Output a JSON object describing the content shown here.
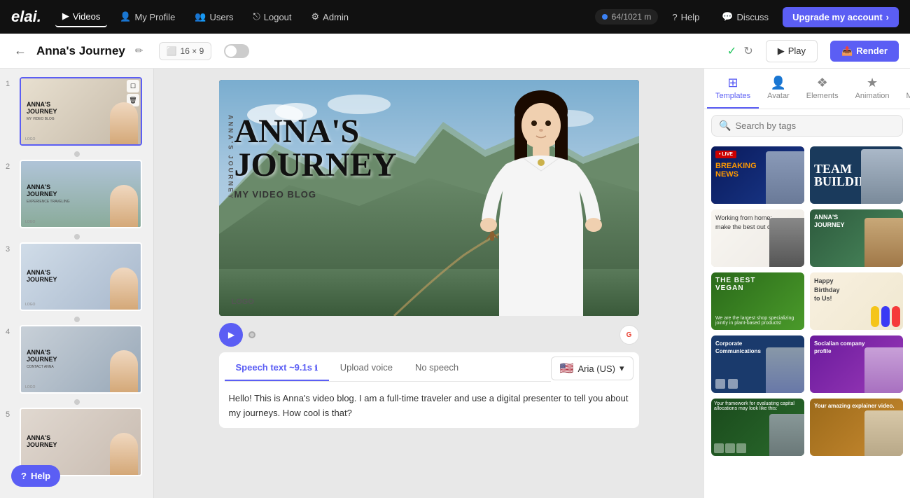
{
  "brand": {
    "logo": "elai."
  },
  "nav": {
    "items": [
      {
        "id": "videos",
        "label": "Videos",
        "icon": "▶",
        "active": true
      },
      {
        "id": "my-profile",
        "label": "My Profile",
        "icon": "👤",
        "active": false
      },
      {
        "id": "users",
        "label": "Users",
        "icon": "👥",
        "active": false
      },
      {
        "id": "logout",
        "label": "Logout",
        "icon": "⎋",
        "active": false
      },
      {
        "id": "admin",
        "label": "Admin",
        "icon": "⚙",
        "active": false
      }
    ],
    "usage": "64/1021 m",
    "help_label": "Help",
    "discuss_label": "Discuss",
    "upgrade_label": "Upgrade my account"
  },
  "secondary_bar": {
    "project_title": "Anna's Journey",
    "aspect_ratio": "16 × 9",
    "play_label": "Play",
    "render_label": "Render"
  },
  "slides": [
    {
      "num": "1",
      "title": "ANNA'S\nJOURNEY",
      "sub": "MY VIDEO BLOG",
      "logo": "LOGO"
    },
    {
      "num": "2",
      "title": "ANNA'S\nJOURNEY",
      "sub": "EXPERIENCE TRAVELING",
      "logo": "LOGO"
    },
    {
      "num": "3",
      "title": "ANNA'S\nJOURNEY",
      "sub": "",
      "logo": "LOGO"
    },
    {
      "num": "4",
      "title": "ANNA'S\nJOURNEY",
      "sub": "CONTACT ANNA",
      "logo": "LOGO"
    },
    {
      "num": "5",
      "title": "ANNA'S\nJOURNEY",
      "sub": "",
      "logo": "LOGO"
    }
  ],
  "canvas": {
    "title_line1": "ANNA'S",
    "title_line2": "JOURNEY",
    "subtitle": "MY VIDEO BLOG",
    "logo": "LOGO",
    "side_text": "ANNA'S JOURNEY"
  },
  "speech": {
    "tab_speech": "Speech text ~9.1s",
    "tab_upload": "Upload voice",
    "tab_none": "No speech",
    "voice_label": "Aria (US)",
    "content": "Hello! This is Anna's video blog. I am a full-time traveler and use a digital presenter to tell you about my journeys. How cool is that?"
  },
  "right_panel": {
    "tabs": [
      {
        "id": "templates",
        "label": "Templates",
        "icon": "⊞",
        "active": true
      },
      {
        "id": "avatar",
        "label": "Avatar",
        "icon": "👤",
        "active": false
      },
      {
        "id": "elements",
        "label": "Elements",
        "icon": "❖",
        "active": false
      },
      {
        "id": "animation",
        "label": "Animation",
        "icon": "★",
        "active": false
      },
      {
        "id": "music",
        "label": "Music",
        "icon": "♪",
        "active": false
      }
    ],
    "search_placeholder": "Search by tags",
    "templates": [
      {
        "id": 1,
        "label": "LIVE BREAKING NEWS",
        "style": "tc-1"
      },
      {
        "id": 2,
        "label": "TEAM BUILDING",
        "style": "tc-2"
      },
      {
        "id": 3,
        "label": "Working from home: make the best out of it",
        "style": "tc-3"
      },
      {
        "id": 4,
        "label": "ANNA'S JOURNEY",
        "style": "tc-4"
      },
      {
        "id": 5,
        "label": "THE BEST VEGAN",
        "style": "tc-5"
      },
      {
        "id": 6,
        "label": "Happy Birthday to Us!",
        "style": "tc-6"
      },
      {
        "id": 7,
        "label": "Corporate Communications",
        "style": "tc-7"
      },
      {
        "id": 8,
        "label": "Socialian company profile",
        "style": "tc-8"
      },
      {
        "id": 9,
        "label": "",
        "style": "tc-9"
      },
      {
        "id": 10,
        "label": "Your amazing explainer video.",
        "style": "tc-10"
      }
    ]
  },
  "help": {
    "label": "Help"
  }
}
